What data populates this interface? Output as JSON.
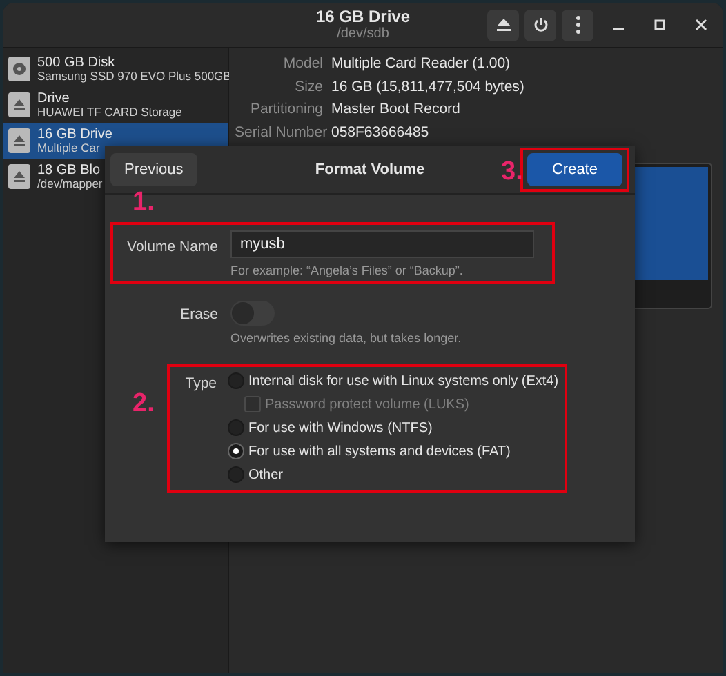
{
  "window": {
    "title": "16 GB Drive",
    "subtitle": "/dev/sdb"
  },
  "sidebar": {
    "items": [
      {
        "kind": "disk",
        "title": "500 GB Disk",
        "subtitle": "Samsung SSD 970 EVO Plus 500GB",
        "selected": false
      },
      {
        "kind": "removable",
        "title": "Drive",
        "subtitle": "HUAWEI TF CARD Storage",
        "selected": false
      },
      {
        "kind": "removable",
        "title": "16 GB Drive",
        "subtitle": "Multiple Car",
        "selected": true
      },
      {
        "kind": "removable",
        "title": "18 GB Blo",
        "subtitle": "/dev/mapper",
        "selected": false
      }
    ]
  },
  "details": [
    {
      "label": "Model",
      "value": "Multiple Card  Reader (1.00)"
    },
    {
      "label": "Size",
      "value": "16 GB (15,811,477,504 bytes)"
    },
    {
      "label": "Partitioning",
      "value": "Master Boot Record"
    },
    {
      "label": "Serial Number",
      "value": "058F63666485"
    }
  ],
  "dialog": {
    "title": "Format Volume",
    "previous_button": "Previous",
    "create_button": "Create",
    "volume_name": {
      "label": "Volume Name",
      "value": "myusb",
      "hint": "For example: “Angela’s Files” or “Backup”."
    },
    "erase": {
      "label": "Erase",
      "on": false,
      "hint": "Overwrites existing data, but takes longer."
    },
    "type": {
      "label": "Type",
      "options": [
        {
          "kind": "radio",
          "label": "Internal disk for use with Linux systems only (Ext4)",
          "selected": false
        },
        {
          "kind": "checkbox",
          "label": "Password protect volume (LUKS)",
          "checked": false,
          "disabled": true
        },
        {
          "kind": "radio",
          "label": "For use with Windows (NTFS)",
          "selected": false
        },
        {
          "kind": "radio",
          "label": "For use with all systems and devices (FAT)",
          "selected": true
        },
        {
          "kind": "radio",
          "label": "Other",
          "selected": false
        }
      ]
    }
  },
  "annotations": [
    {
      "label": "1."
    },
    {
      "label": "2."
    },
    {
      "label": "3."
    }
  ]
}
